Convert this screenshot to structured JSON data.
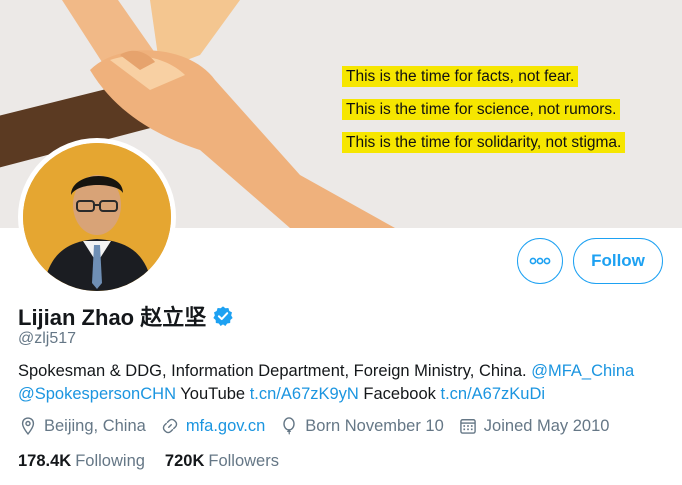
{
  "banner": {
    "lines": [
      "This is the time for facts, not fear.",
      "This is the time for science, not rumors.",
      "This is the time for solidarity, not stigma."
    ]
  },
  "actions": {
    "follow_label": "Follow"
  },
  "profile": {
    "name": "Lijian Zhao 赵立坚",
    "handle": "@zlj517",
    "verified": true,
    "bio_text_1": "Spokesman & DDG, Information Department, Foreign Ministry, China. ",
    "bio_link_1": "@MFA_China",
    "bio_link_2": "@SpokespersonCHN",
    "bio_text_2": " YouTube ",
    "bio_link_3": "t.cn/A67zK9yN",
    "bio_text_3": " Facebook ",
    "bio_link_4": "t.cn/A67zKuDi",
    "location": "Beijing, China",
    "website": "mfa.gov.cn",
    "born": "Born November 10",
    "joined": "Joined May 2010"
  },
  "stats": {
    "following_count": "178.4K",
    "following_label": "Following",
    "followers_count": "720K",
    "followers_label": "Followers"
  },
  "colors": {
    "accent": "#1da1f2",
    "highlight": "#f6e600",
    "avatar_bg": "#e5a631"
  },
  "icons": [
    "more-icon",
    "verified-badge-icon",
    "location-icon",
    "link-icon",
    "balloon-icon",
    "calendar-icon"
  ]
}
